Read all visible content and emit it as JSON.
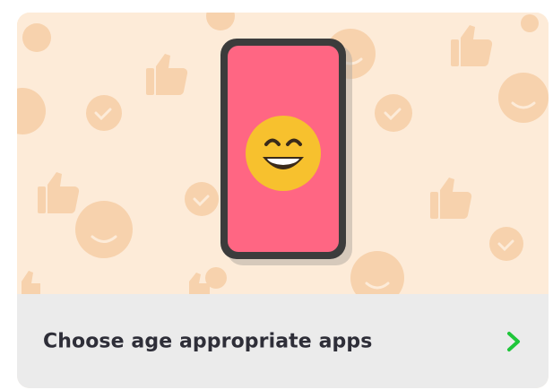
{
  "card": {
    "label": "Choose age appropriate apps",
    "illustration_icon": "smiling-phone-icon",
    "action_icon": "chevron-right-icon"
  },
  "colors": {
    "hero_background": "#fdebd8",
    "pattern": "#f7d2ad",
    "phone_body": "#3c3c3c",
    "phone_screen": "#ff6683",
    "emoji_face": "#f7c12e",
    "footer_background": "#ebebeb",
    "label_text": "#2e2e38",
    "chevron": "#1fc63a"
  }
}
